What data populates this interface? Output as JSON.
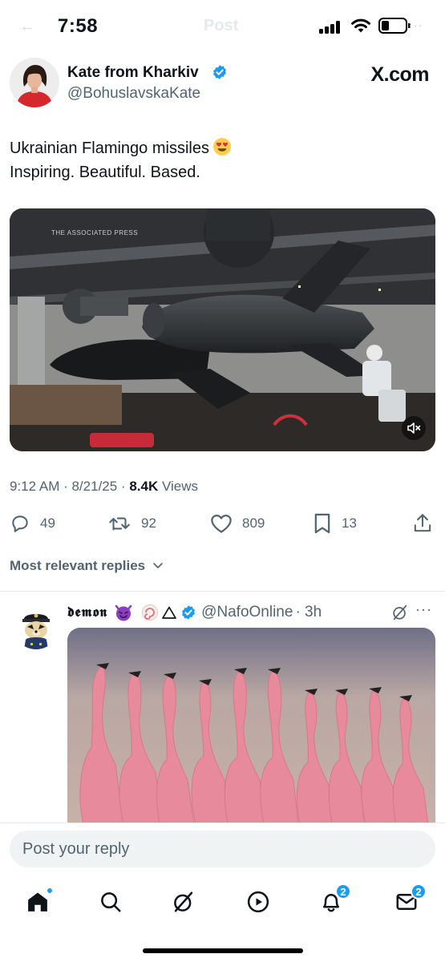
{
  "status_bar": {
    "time": "7:58",
    "battery_level": 0.25
  },
  "header_ghost": {
    "back": "←",
    "title": "Post",
    "more": "⋯"
  },
  "author": {
    "name": "Kate from Kharkiv",
    "handle": "@BohuslavskaKate",
    "verified": true
  },
  "watermark": "X.com",
  "tweet": {
    "line1": "Ukrainian Flamingo missiles",
    "emoji": "smiling-face-with-heart-eyes",
    "line2": "Inspiring. Beautiful. Based.",
    "media_watermark": "THE ASSOCIATED PRESS",
    "posted": "9:12 AM · 8/21/25 ·",
    "views_count": "8.4K",
    "views_label": "Views"
  },
  "actions": {
    "replies": "49",
    "reposts": "92",
    "likes": "809",
    "bookmarks": "13"
  },
  "replies_sort": {
    "label": "Most relevant replies"
  },
  "reply": {
    "name": "𝖉𝖊𝖒𝖔𝖓",
    "handle": "@NafoOnline",
    "time": "· 3h",
    "more": "···"
  },
  "compose": {
    "placeholder": "Post your reply"
  },
  "nav": {
    "notifications_badge": "2",
    "messages_badge": "2"
  },
  "colors": {
    "accent": "#1d9bf0",
    "secondary_text": "#536471",
    "primary_text": "#0f1419"
  }
}
